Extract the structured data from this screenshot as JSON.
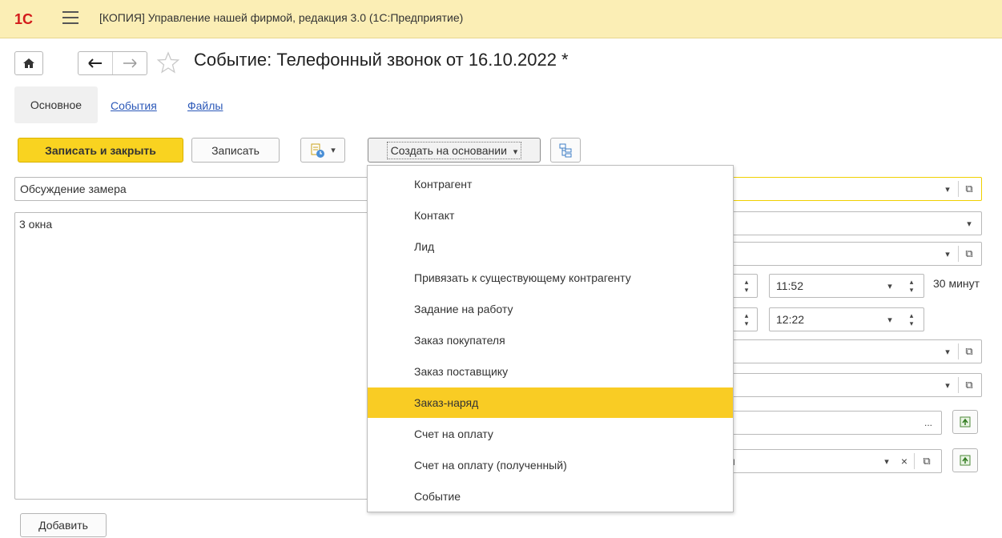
{
  "window": {
    "title": "[КОПИЯ] Управление нашей фирмой, редакция 3.0  (1С:Предприятие)",
    "logo_text": "1С"
  },
  "header": {
    "doc_title": "Событие: Телефонный звонок от 16.10.2022 *"
  },
  "tabs": [
    {
      "label": "Основное",
      "active": true
    },
    {
      "label": "События"
    },
    {
      "label": "Файлы"
    }
  ],
  "toolbar": {
    "save_close": "Записать и закрыть",
    "save": "Записать",
    "create_based": "Создать на основании"
  },
  "form": {
    "subject": "Обсуждение замера",
    "content": "3 окна",
    "time_start": "11:52",
    "time_end": "12:22",
    "duration": "30 минут",
    "last_field_tail": "н"
  },
  "menu": {
    "items": [
      "Контрагент",
      "Контакт",
      "Лид",
      "Привязать к существующему контрагенту",
      "Задание на работу",
      "Заказ покупателя",
      "Заказ поставщику",
      "Заказ-наряд",
      "Счет на оплату",
      "Счет на оплату (полученный)",
      "Событие"
    ],
    "highlighted": "Заказ-наряд"
  },
  "footer": {
    "add_label": "Добавить"
  },
  "icons": {
    "dropdown_glyph": "▾",
    "open_glyph": "⧉",
    "clear_glyph": "×",
    "ellipsis_glyph": "..."
  },
  "colors": {
    "titlebar_bg": "#fbeeb5",
    "primary_button": "#f9d320",
    "menu_highlight": "#f9cc24",
    "link": "#2b58b8",
    "logo": "#d31b1b"
  }
}
